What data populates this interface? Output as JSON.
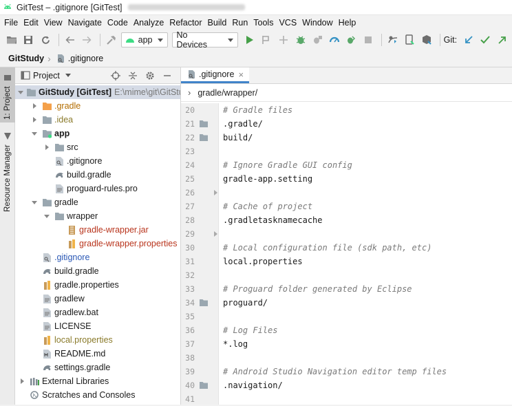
{
  "window": {
    "title": "GitTest – .gitignore [GitTest]"
  },
  "menu": [
    "File",
    "Edit",
    "View",
    "Navigate",
    "Code",
    "Analyze",
    "Refactor",
    "Build",
    "Run",
    "Tools",
    "VCS",
    "Window",
    "Help"
  ],
  "toolbar": {
    "module_combo": "app",
    "device_combo": "No Devices",
    "git_label": "Git:"
  },
  "breadcrumb": {
    "project": "GitStudy",
    "file": ".gitignore"
  },
  "sidebar_tabs": {
    "project_tab": "1: Project",
    "resource_tab": "Resource Manager"
  },
  "project_panel": {
    "title": "Project",
    "tree": [
      {
        "label": "GitStudy [GitTest]",
        "extra": "E:\\mime\\git\\GitStudy",
        "arrow": "down",
        "icon": "folder-gray",
        "indent": 0,
        "style": "bold"
      },
      {
        "label": ".gradle",
        "arrow": "right",
        "icon": "folder-orange",
        "indent": 1,
        "style": "orange"
      },
      {
        "label": ".idea",
        "arrow": "right",
        "icon": "folder-gray",
        "indent": 1,
        "style": "olive"
      },
      {
        "label": "app",
        "arrow": "down",
        "icon": "folder-module",
        "indent": 1,
        "style": "bold"
      },
      {
        "label": "src",
        "arrow": "right",
        "icon": "folder-gray",
        "indent": 2,
        "style": "normal"
      },
      {
        "label": ".gitignore",
        "arrow": "none",
        "icon": "file-gitignore",
        "indent": 2,
        "style": "normal"
      },
      {
        "label": "build.gradle",
        "arrow": "none",
        "icon": "file-gradle",
        "indent": 2,
        "style": "normal"
      },
      {
        "label": "proguard-rules.pro",
        "arrow": "none",
        "icon": "file-text",
        "indent": 2,
        "style": "normal"
      },
      {
        "label": "gradle",
        "arrow": "down",
        "icon": "folder-gray",
        "indent": 1,
        "style": "normal"
      },
      {
        "label": "wrapper",
        "arrow": "down",
        "icon": "folder-gray",
        "indent": 2,
        "style": "normal"
      },
      {
        "label": "gradle-wrapper.jar",
        "arrow": "none",
        "icon": "file-jar",
        "indent": 3,
        "style": "red"
      },
      {
        "label": "gradle-wrapper.properties",
        "arrow": "none",
        "icon": "file-properties",
        "indent": 3,
        "style": "red"
      },
      {
        "label": ".gitignore",
        "arrow": "none",
        "icon": "file-gitignore",
        "indent": 1,
        "style": "blue"
      },
      {
        "label": "build.gradle",
        "arrow": "none",
        "icon": "file-gradle",
        "indent": 1,
        "style": "normal"
      },
      {
        "label": "gradle.properties",
        "arrow": "none",
        "icon": "file-properties",
        "indent": 1,
        "style": "normal"
      },
      {
        "label": "gradlew",
        "arrow": "none",
        "icon": "file-text",
        "indent": 1,
        "style": "normal"
      },
      {
        "label": "gradlew.bat",
        "arrow": "none",
        "icon": "file-text",
        "indent": 1,
        "style": "normal"
      },
      {
        "label": "LICENSE",
        "arrow": "none",
        "icon": "file-text",
        "indent": 1,
        "style": "normal"
      },
      {
        "label": "local.properties",
        "arrow": "none",
        "icon": "file-properties",
        "indent": 1,
        "style": "olive"
      },
      {
        "label": "README.md",
        "arrow": "none",
        "icon": "file-md",
        "indent": 1,
        "style": "normal"
      },
      {
        "label": "settings.gradle",
        "arrow": "none",
        "icon": "file-gradle",
        "indent": 1,
        "style": "normal"
      },
      {
        "label": "External Libraries",
        "arrow": "right",
        "icon": "libraries",
        "indent": 0,
        "style": "normal"
      },
      {
        "label": "Scratches and Consoles",
        "arrow": "none",
        "icon": "scratches",
        "indent": 0,
        "style": "normal"
      }
    ]
  },
  "editor": {
    "tab_label": ".gitignore",
    "breadcrumb_path": "gradle/wrapper/",
    "lines": [
      {
        "n": "20",
        "text": "# Gradle files",
        "kind": "comment",
        "gut": "",
        "fold": false
      },
      {
        "n": "21",
        "text": ".gradle/",
        "kind": "normal",
        "gut": "folder",
        "fold": false
      },
      {
        "n": "22",
        "text": "build/",
        "kind": "normal",
        "gut": "folder",
        "fold": false
      },
      {
        "n": "23",
        "text": "",
        "kind": "normal",
        "gut": "",
        "fold": false
      },
      {
        "n": "24",
        "text": "# Ignore Gradle GUI config",
        "kind": "comment",
        "gut": "",
        "fold": false
      },
      {
        "n": "25",
        "text": "gradle-app.setting",
        "kind": "normal",
        "gut": "",
        "fold": false
      },
      {
        "n": "26",
        "text": "",
        "kind": "normal",
        "gut": "",
        "fold": true
      },
      {
        "n": "27",
        "text": "# Cache of project",
        "kind": "comment",
        "gut": "",
        "fold": false
      },
      {
        "n": "28",
        "text": ".gradletasknamecache",
        "kind": "normal",
        "gut": "",
        "fold": false
      },
      {
        "n": "29",
        "text": "",
        "kind": "normal",
        "gut": "",
        "fold": true
      },
      {
        "n": "30",
        "text": "# Local configuration file (sdk path, etc)",
        "kind": "comment",
        "gut": "",
        "fold": false
      },
      {
        "n": "31",
        "text": "local.properties",
        "kind": "normal",
        "gut": "",
        "fold": false
      },
      {
        "n": "32",
        "text": "",
        "kind": "normal",
        "gut": "",
        "fold": false
      },
      {
        "n": "33",
        "text": "# Proguard folder generated by Eclipse",
        "kind": "comment",
        "gut": "",
        "fold": false
      },
      {
        "n": "34",
        "text": "proguard/",
        "kind": "normal",
        "gut": "folder",
        "fold": false
      },
      {
        "n": "35",
        "text": "",
        "kind": "normal",
        "gut": "",
        "fold": false
      },
      {
        "n": "36",
        "text": "# Log Files",
        "kind": "comment",
        "gut": "",
        "fold": false
      },
      {
        "n": "37",
        "text": "*.log",
        "kind": "normal",
        "gut": "",
        "fold": false
      },
      {
        "n": "38",
        "text": "",
        "kind": "normal",
        "gut": "",
        "fold": false
      },
      {
        "n": "39",
        "text": "# Android Studio Navigation editor temp files",
        "kind": "comment",
        "gut": "",
        "fold": false
      },
      {
        "n": "40",
        "text": ".navigation/",
        "kind": "normal",
        "gut": "folder",
        "fold": false
      },
      {
        "n": "41",
        "text": "",
        "kind": "normal",
        "gut": "",
        "fold": false
      }
    ]
  }
}
